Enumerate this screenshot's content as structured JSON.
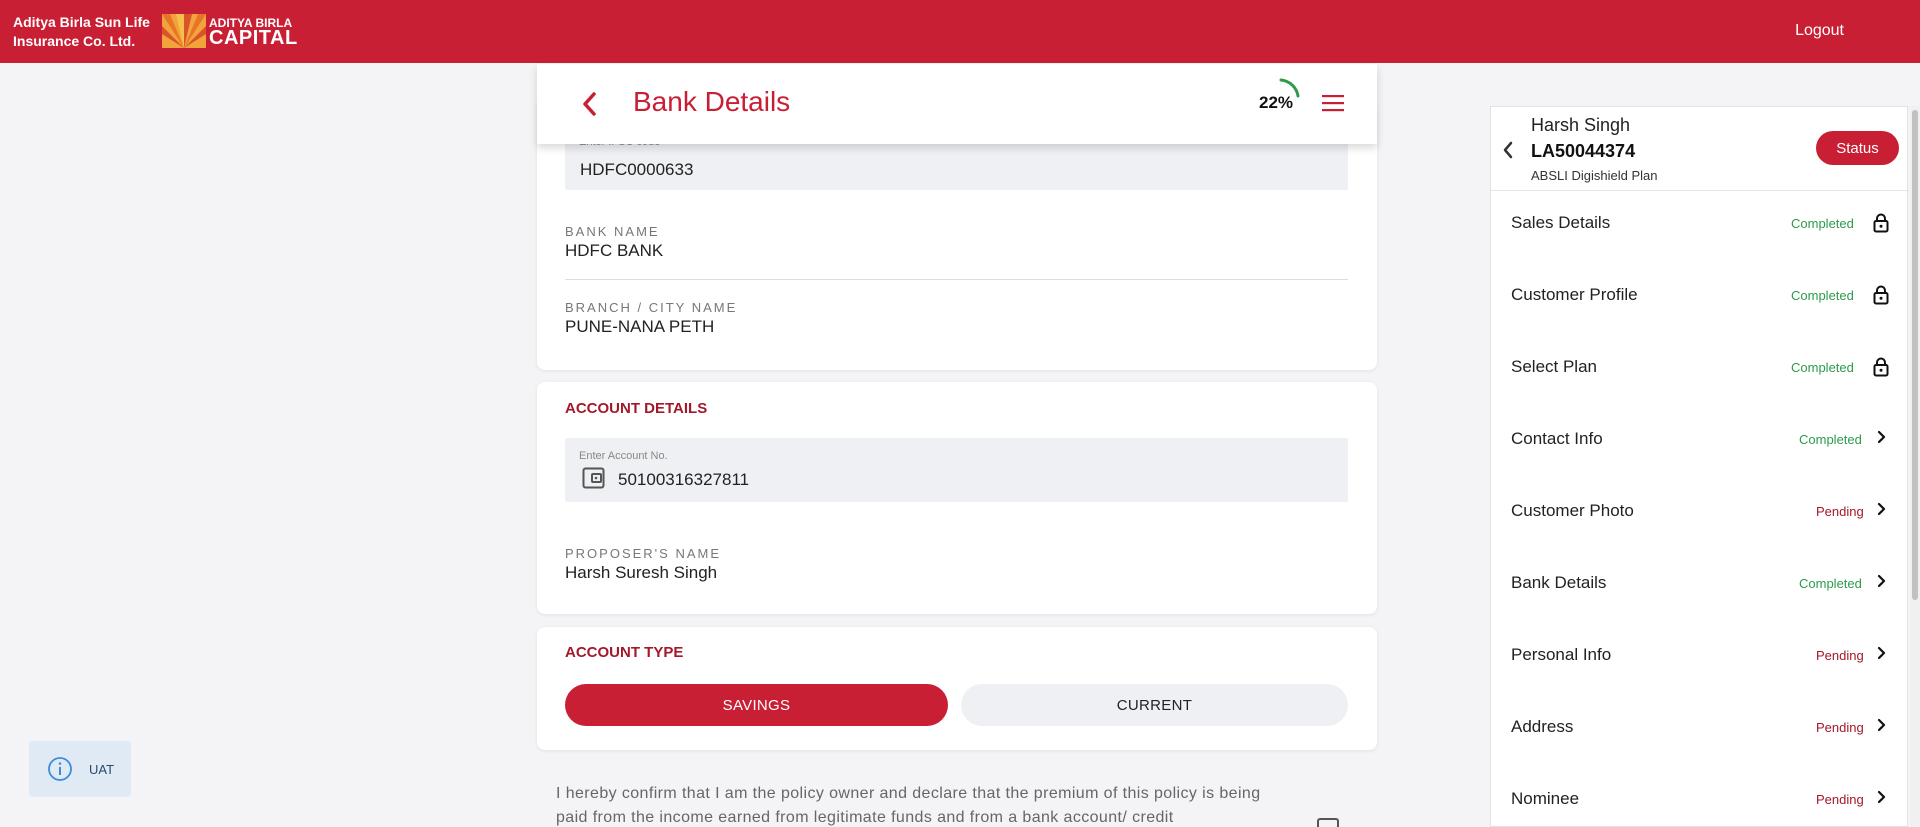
{
  "topbar": {
    "brand_line1": "Aditya Birla Sun Life",
    "brand_line2": "Insurance Co. Ltd.",
    "logo_line1": "ADITYA BIRLA",
    "logo_line2": "CAPITAL",
    "logout_label": "Logout"
  },
  "header": {
    "title": "Bank Details",
    "progress_label": "22%",
    "progress_value": 0.22
  },
  "bank": {
    "ifsc_label": "Enter IFSC code",
    "ifsc_value": "HDFC0000633",
    "bank_name_label": "BANK NAME",
    "bank_name_value": "HDFC BANK",
    "branch_label": "BRANCH / CITY NAME",
    "branch_value": "PUNE-NANA PETH"
  },
  "account": {
    "section_title": "ACCOUNT DETAILS",
    "account_no_label": "Enter Account No.",
    "account_no_value": "50100316327811",
    "proposer_label": "PROPOSER'S NAME",
    "proposer_value": "Harsh Suresh Singh"
  },
  "account_type": {
    "section_title": "ACCOUNT TYPE",
    "savings_label": "SAVINGS",
    "current_label": "CURRENT",
    "selected": "SAVINGS"
  },
  "declaration": {
    "text": "I hereby confirm that I am the policy owner and declare that the premium of this policy is being paid from the income earned from legitimate funds and from a bank account/ credit"
  },
  "uat": {
    "label": "UAT"
  },
  "side": {
    "name": "Harsh Singh",
    "app_id": "LA50044374",
    "plan": "ABSLI Digishield Plan",
    "status_label": "Status",
    "items": [
      {
        "label": "Sales Details",
        "status": "Completed",
        "icon": "lock-icon"
      },
      {
        "label": "Customer Profile",
        "status": "Completed",
        "icon": "lock-icon"
      },
      {
        "label": "Select Plan",
        "status": "Completed",
        "icon": "lock-icon"
      },
      {
        "label": "Contact Info",
        "status": "Completed",
        "icon": "chevron-right-icon"
      },
      {
        "label": "Customer Photo",
        "status": "Pending",
        "icon": "chevron-right-icon"
      },
      {
        "label": "Bank Details",
        "status": "Completed",
        "icon": "chevron-right-icon"
      },
      {
        "label": "Personal Info",
        "status": "Pending",
        "icon": "chevron-right-icon"
      },
      {
        "label": "Address",
        "status": "Pending",
        "icon": "chevron-right-icon"
      },
      {
        "label": "Nominee",
        "status": "Pending",
        "icon": "chevron-right-icon"
      }
    ]
  },
  "colors": {
    "brand_red": "#c91f34",
    "completed_green": "#2e9b4a",
    "pending_red": "#a3192a"
  }
}
